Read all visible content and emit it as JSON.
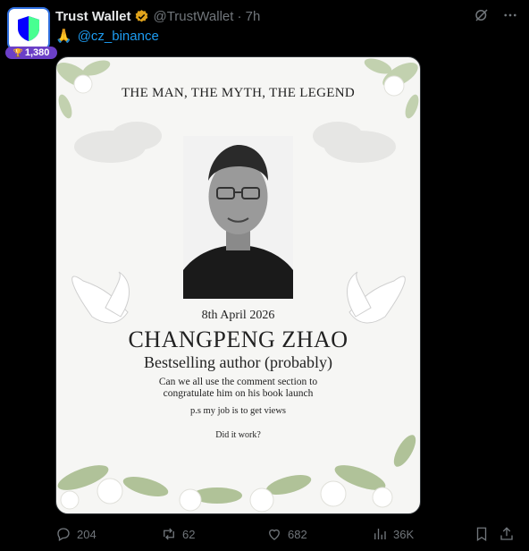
{
  "author": {
    "name": "Trust Wallet",
    "handle": "@TrustWallet",
    "time": "· 7h",
    "badge_count": "1,380",
    "verified_color": "#e0a31c"
  },
  "tweet": {
    "emoji": "🙏",
    "mention": "@cz_binance"
  },
  "media": {
    "top_line": "THE MAN, THE MYTH, THE LEGEND",
    "date": "8th April 2026",
    "name": "CHANGPENG ZHAO",
    "subtitle": "Bestselling author (probably)",
    "ask_line1": "Can we all use the comment section to",
    "ask_line2": "congratulate him on his book launch",
    "ps": "p.s my job is to get views",
    "question": "Did it work?"
  },
  "actions": {
    "replies": "204",
    "reposts": "62",
    "likes": "682",
    "views": "36K"
  },
  "colors": {
    "accent": "#1d9bf0",
    "muted": "#71767b",
    "badge_bg": "#6b3fc7"
  },
  "icons": [
    "shield-icon",
    "verified-icon",
    "grok-icon",
    "more-icon",
    "reply-icon",
    "repost-icon",
    "like-icon",
    "views-icon",
    "bookmark-icon",
    "share-icon"
  ]
}
